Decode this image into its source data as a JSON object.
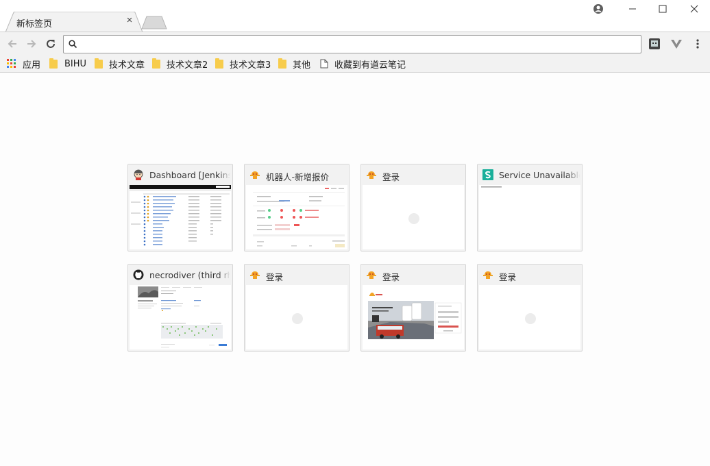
{
  "tab": {
    "title": "新标签页",
    "close": "×"
  },
  "omnibox": {
    "value": "",
    "placeholder": ""
  },
  "bookmarks": {
    "apps_label": "应用",
    "items": [
      {
        "label": "BIHU",
        "icon": "folder-icon"
      },
      {
        "label": "技术文章",
        "icon": "folder-icon"
      },
      {
        "label": "技术文章2",
        "icon": "folder-icon"
      },
      {
        "label": "技术文章3",
        "icon": "folder-icon"
      },
      {
        "label": "其他",
        "icon": "folder-icon"
      },
      {
        "label": "收藏到有道云笔记",
        "icon": "page-icon"
      }
    ]
  },
  "tiles": [
    {
      "title": "Dashboard [Jenkins]",
      "favicon": "jenkins-icon"
    },
    {
      "title": "机器人-新增报价",
      "favicon": "robot-icon"
    },
    {
      "title": "登录",
      "favicon": "robot-icon"
    },
    {
      "title": "Service Unavailable",
      "favicon": "s-icon"
    },
    {
      "title": "necrodiver (third rhapsody)",
      "favicon": "github-icon"
    },
    {
      "title": "登录",
      "favicon": "robot-icon"
    },
    {
      "title": "登录",
      "favicon": "robot-icon"
    },
    {
      "title": "登录",
      "favicon": "robot-icon"
    }
  ],
  "colors": {
    "accent_folder": "#f7cc4b",
    "s_icon": "#1aaf9a",
    "robot": "#f3a324"
  }
}
